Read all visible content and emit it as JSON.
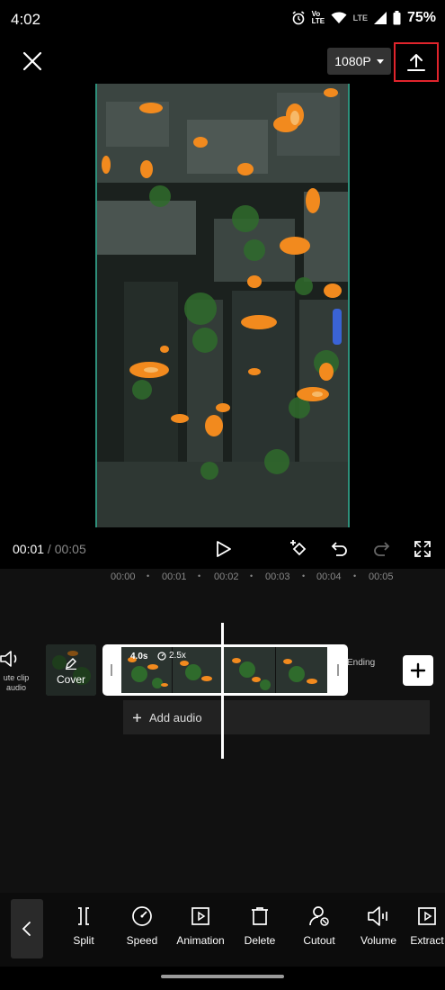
{
  "status_bar": {
    "time": "4:02",
    "volte_label": "Vo LTE",
    "network_label": "LTE",
    "battery": "75%"
  },
  "top_bar": {
    "resolution": "1080P"
  },
  "playback": {
    "current_time": "00:01",
    "separator": " / ",
    "total_time": "00:05"
  },
  "timeline": {
    "ruler": [
      "00:00",
      "00:01",
      "00:02",
      "00:03",
      "00:04",
      "00:05"
    ],
    "dot": "•",
    "mute_label": "ute clip\naudio",
    "cover_label": "Cover",
    "clip_duration": "4.0s",
    "clip_speed": "2.5x",
    "ending_label": "Ending",
    "add_audio_label": "Add audio"
  },
  "toolbar": {
    "tools": [
      {
        "label": "Split",
        "icon": "split-icon"
      },
      {
        "label": "Speed",
        "icon": "speed-icon"
      },
      {
        "label": "Animation",
        "icon": "animation-icon"
      },
      {
        "label": "Delete",
        "icon": "delete-icon"
      },
      {
        "label": "Cutout",
        "icon": "cutout-icon"
      },
      {
        "label": "Volume",
        "icon": "volume-icon"
      },
      {
        "label": "Extract",
        "icon": "extract-icon"
      }
    ]
  },
  "colors": {
    "accent_outline": "#e0242c",
    "preview_border": "#2e8f7a"
  }
}
